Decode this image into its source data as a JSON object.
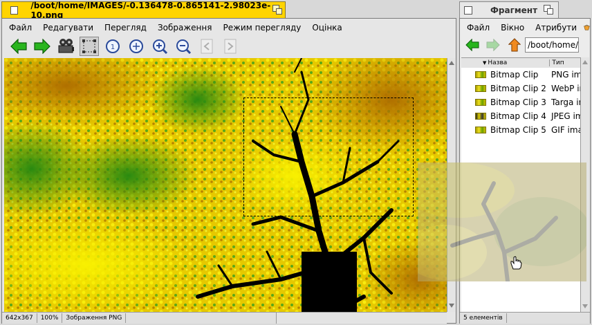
{
  "main_window": {
    "title": "/boot/home/IMAGES/-0.136478-0.865141-2.98023e-10.png",
    "menu": [
      "Файл",
      "Редагувати",
      "Перегляд",
      "Зображення",
      "Режим перегляду",
      "Оцінка"
    ],
    "status": {
      "size": "642x367",
      "zoom": "100%",
      "type": "Зображення PNG"
    }
  },
  "fragment_window": {
    "title": "Фрагмент",
    "menu": [
      "Файл",
      "Вікно",
      "Атрибути"
    ],
    "path": "/boot/home/I",
    "columns": {
      "name": "Назва",
      "type": "Тип"
    },
    "items": [
      {
        "name": "Bitmap Clip",
        "type": "PNG im"
      },
      {
        "name": "Bitmap Clip 2",
        "type": "WebP im"
      },
      {
        "name": "Bitmap Clip 3",
        "type": "Targa im"
      },
      {
        "name": "Bitmap Clip 4",
        "type": "JPEG im"
      },
      {
        "name": "Bitmap Clip 5",
        "type": "GIF ima"
      }
    ],
    "status": "5 елементів"
  },
  "colors": {
    "tab_active": "#ffd400",
    "tab_inactive": "#e8e8e8",
    "fractal_yellow": "#f5e000",
    "fractal_green": "#4aa010",
    "fractal_brown": "#a87000"
  }
}
